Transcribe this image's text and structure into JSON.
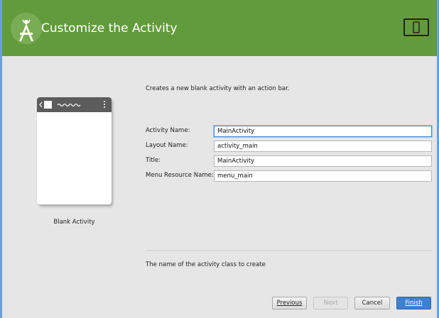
{
  "header": {
    "title": "Customize the Activity",
    "background_color": "#629b3c"
  },
  "preview": {
    "label": "Blank Activity"
  },
  "description": "Creates a new blank activity with an action bar.",
  "form": {
    "fields": [
      {
        "label": "Activity Name:",
        "value": "MainActivity"
      },
      {
        "label": "Layout Name:",
        "value": "activity_main"
      },
      {
        "label": "Title:",
        "value": "MainActivity"
      },
      {
        "label": "Menu Resource Name:",
        "value": "menu_main"
      }
    ]
  },
  "help_text": "The name of the activity class to create",
  "buttons": {
    "previous": "Previous",
    "next": "Next",
    "cancel": "Cancel",
    "finish": "Finish"
  },
  "icons": {
    "logo": "android-studio-logo-icon",
    "device": "tablet-phone-icon",
    "back": "back-arrow-icon",
    "overflow": "overflow-menu-icon"
  }
}
